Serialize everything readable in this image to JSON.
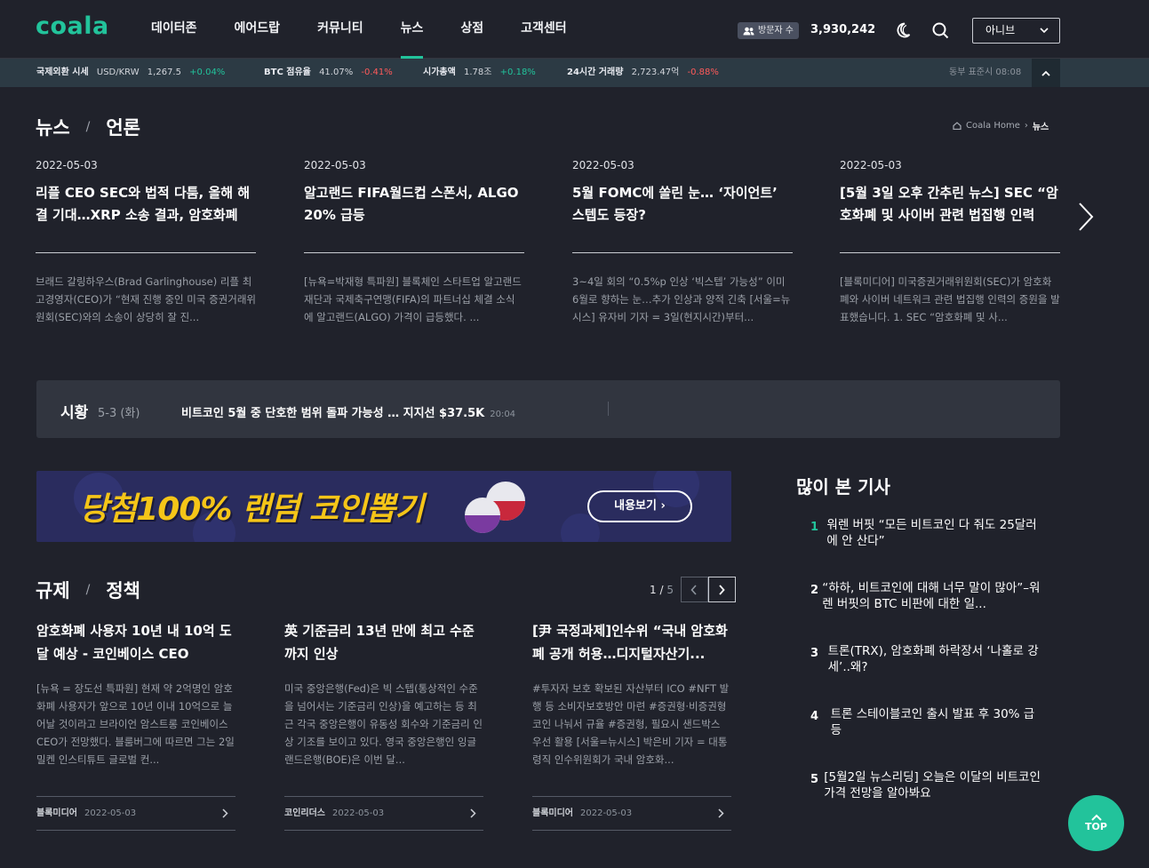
{
  "header": {
    "logo": "coala",
    "nav": [
      "데이터존",
      "에어드랍",
      "커뮤니티",
      "뉴스",
      "상점",
      "고객센터"
    ],
    "active_nav": "뉴스",
    "visitor_label": "방문자 수",
    "visitor_count": "3,930,242",
    "lang": "아니브"
  },
  "ticker": {
    "items": [
      {
        "label": "국제외환 시세",
        "name": "USD/KRW",
        "value": "1,267.5",
        "change": "+0.04%",
        "dir": "up"
      },
      {
        "label": "BTC 점유율",
        "name": "",
        "value": "41.07%",
        "change": "-0.41%",
        "dir": "down"
      },
      {
        "label": "시가총액",
        "name": "",
        "value": "1.78조",
        "change": "+0.18%",
        "dir": "up"
      },
      {
        "label": "24시간 거래량",
        "name": "",
        "value": "2,723.47억",
        "change": "-0.88%",
        "dir": "down"
      }
    ],
    "time": "동부 표준시 08:08"
  },
  "news_section": {
    "title": "뉴스",
    "subtitle": "언론",
    "breadcrumb_home": "Coala Home",
    "breadcrumb_current": "뉴스",
    "cards": [
      {
        "date": "2022-05-03",
        "title": "리플 CEO SEC와 법적 다툼, 올해 해결 기대…XRP 소송 결과, 암호화폐",
        "desc": " 브래드 갈링하우스(Brad Garlinghouse) 리플 최고경영자(CEO)가 “현재 진행 중인 미국 증권거래위원회(SEC)와의 소송이 상당히 잘 진..."
      },
      {
        "date": "2022-05-03",
        "title": "알고랜드 FIFA월드컵 스폰서, ALGO 20% 급등",
        "desc": "[뉴욕=박재형 특파원] 블록체인 스타트업 알고랜드재단과 국제축구연맹(FIFA)의 파트너십 체결 소식에 알고랜드(ALGO) 가격이 급등했다. ..."
      },
      {
        "date": "2022-05-03",
        "title": "5월 FOMC에 쏠린 눈… ‘자이언트’ 스텝도 등장?",
        "desc": "3~4일 회의 “0.5%p 인상 ‘빅스텝’ 가능성” 이미 6월로 향하는 눈…추가 인상과 양적 긴축 [서울=뉴시스] 유자비 기자 = 3일(현지시간)부터..."
      },
      {
        "date": "2022-05-03",
        "title": "[5월 3일 오후 간추린 뉴스] SEC “암호화폐 및 사이버 관련 법집행 인력",
        "desc": "[블록미디어] 미국증권거래위원회(SEC)가 암호화폐와 사이버 네트워크 관련 법집행 인력의 증원을 발표했습니다. 1. SEC “암호화폐 및 사..."
      }
    ]
  },
  "market": {
    "label": "시황",
    "date": "5-3 (화)",
    "headline": "비트코인 5월 중 단호한 범위 돌파 가능성 … 지지선 $37.5K",
    "time": "20:04"
  },
  "banner": {
    "text": "당첨100% 랜덤 코인뽑기",
    "button": "내용보기 ›"
  },
  "regulation": {
    "title": "규제",
    "subtitle": "정책",
    "page": "1",
    "total": "5",
    "cards": [
      {
        "title": "암호화폐 사용자 10년 내 10억 도달 예상 - 코인베이스 CEO",
        "desc": "[뉴욕 = 장도선 특파원] 현재 약 2억명인 암호화폐 사용자가 앞으로 10년 이내 10억으로 늘어날 것이라고 브라이언 암스트롱 코인베이스 CEO가 전망했다. 블룸버그에 따르면 그는 2일 밀켄 인스티튜트 글로벌 컨...",
        "source": "블록미디어",
        "date": "2022-05-03"
      },
      {
        "title": "英 기준금리 13년 만에 최고 수준까지 인상",
        "desc": "미국 중앙은행(Fed)은 빅 스텝(통상적인 수준을 넘어서는 기준금리 인상)을 예고하는 등 최근 각국 중앙은행이 유동성 회수와 기준금리 인상 기조를 보이고 있다.   영국 중앙은행인 잉글랜드은행(BOE)은 이번 달...",
        "source": "코인리더스",
        "date": "2022-05-03"
      },
      {
        "title": "[尹 국정과제]인수위 “국내 암호화폐 공개 허용…디지털자산기...",
        "desc": "#투자자 보호 확보된 자산부터 ICO #NFT 발행 등 소비자보호방안 마련 #증권형·비증권형 코인 나눠서 규율 #증권형, 필요시 샌드박스 우선 활용 [서울=뉴시스] 박은비 기자 = 대통령직 인수위원회가 국내 암호화...",
        "source": "블록미디어",
        "date": "2022-05-03"
      }
    ]
  },
  "popular": {
    "title": "많이 본 기사",
    "items": [
      {
        "num": "1",
        "text": "워렌 버핏 “모든 비트코인 다 줘도 25달러에 안 산다”"
      },
      {
        "num": "2",
        "text": "“하하, 비트코인에 대해 너무 말이 많아”–워렌 버핏의 BTC 비판에 대한 일..."
      },
      {
        "num": "3",
        "text": "트론(TRX), 암호화폐 하락장서 ‘나홀로 강세’..왜?"
      },
      {
        "num": "4",
        "text": "트론 스테이블코인 출시 발표 후 30% 급등"
      },
      {
        "num": "5",
        "text": "[5월2일 뉴스리딩] 오늘은 이달의 비트코인 가격 전망을 알아봐요"
      }
    ]
  },
  "top_button": "TOP",
  "colors": {
    "accent": "#22c39b",
    "down": "#ff5a5a",
    "bg": "#20222b"
  }
}
